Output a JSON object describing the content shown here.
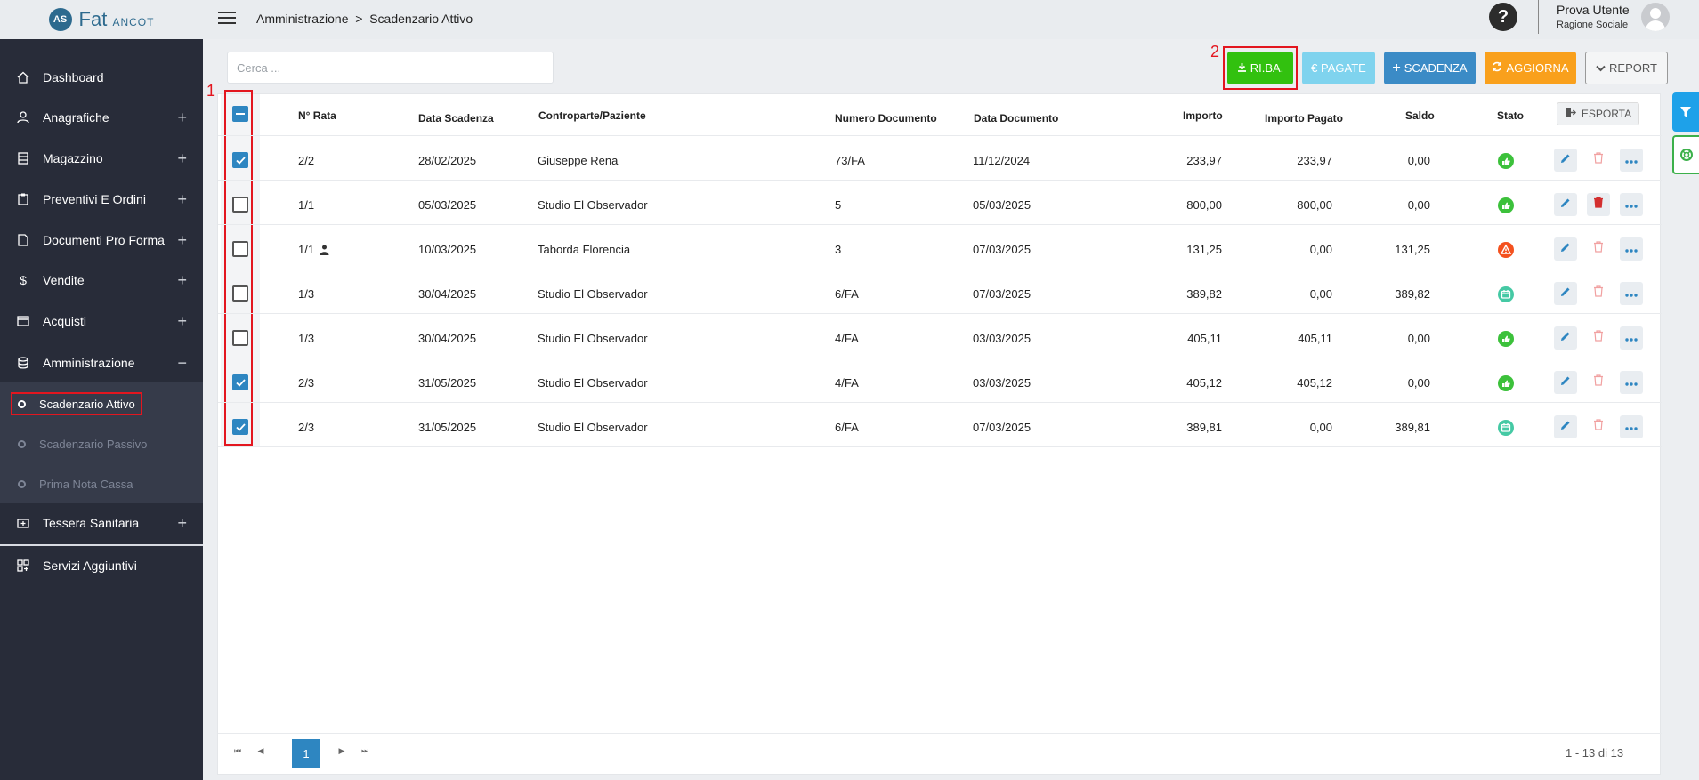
{
  "sidebar": {
    "logo_mark": "AS",
    "logo_text": "Fat",
    "logo_sub": "ANCOT",
    "items": [
      {
        "label": "Dashboard",
        "icon": "home-icon"
      },
      {
        "label": "Anagrafiche",
        "icon": "user-icon"
      },
      {
        "label": "Magazzino",
        "icon": "warehouse-icon"
      },
      {
        "label": "Preventivi E Ordini",
        "icon": "clipboard-icon"
      },
      {
        "label": "Documenti Pro Forma",
        "icon": "document-icon"
      },
      {
        "label": "Vendite",
        "icon": "dollar-icon"
      },
      {
        "label": "Acquisti",
        "icon": "card-icon"
      },
      {
        "label": "Amministrazione",
        "icon": "database-icon"
      },
      {
        "label": "Tessera Sanitaria",
        "icon": "medical-icon"
      },
      {
        "label": "Servizi Aggiuntivi",
        "icon": "apps-icon"
      }
    ],
    "submenu": [
      {
        "label": "Scadenzario Attivo"
      },
      {
        "label": "Scadenzario Passivo"
      },
      {
        "label": "Prima Nota Cassa"
      }
    ]
  },
  "topbar": {
    "breadcrumb": "Amministrazione  >  Scadenzario Attivo",
    "user_name": "Prova Utente",
    "user_role": "Ragione Sociale"
  },
  "toolbar": {
    "search_placeholder": "Cerca ...",
    "riba": "RI.BA.",
    "pagate": "€ PAGATE",
    "scadenza": "SCADENZA",
    "aggiorna": "AGGIORNA",
    "report": "REPORT",
    "annotation_1": "1",
    "annotation_2": "2"
  },
  "table": {
    "headers": {
      "rata": "N° Rata",
      "data_scadenza": "Data Scadenza",
      "controparte": "Controparte/Paziente",
      "numero_doc": "Numero Documento",
      "data_doc": "Data Documento",
      "importo": "Importo",
      "importo_pagato": "Importo Pagato",
      "saldo": "Saldo",
      "stato": "Stato",
      "esporta": "ESPORTA"
    },
    "rows": [
      {
        "checked": true,
        "rata": "2/2",
        "scadenza": "28/02/2025",
        "controparte": "Giuseppe Rena",
        "numero": "73/FA",
        "data_doc": "11/12/2024",
        "importo": "233,97",
        "pagato": "233,97",
        "saldo": "0,00",
        "stato": "paid",
        "delete_enabled": false
      },
      {
        "checked": false,
        "rata": "1/1",
        "scadenza": "05/03/2025",
        "controparte": "Studio El Observador",
        "numero": "5",
        "data_doc": "05/03/2025",
        "importo": "800,00",
        "pagato": "800,00",
        "saldo": "0,00",
        "stato": "paid",
        "delete_enabled": true
      },
      {
        "checked": false,
        "rata": "1/1",
        "scadenza": "10/03/2025",
        "controparte": "Taborda Florencia",
        "numero": "3",
        "data_doc": "07/03/2025",
        "importo": "131,25",
        "pagato": "0,00",
        "saldo": "131,25",
        "stato": "overdue",
        "delete_enabled": false,
        "has_person_icon": true
      },
      {
        "checked": false,
        "rata": "1/3",
        "scadenza": "30/04/2025",
        "controparte": "Studio El Observador",
        "numero": "6/FA",
        "data_doc": "07/03/2025",
        "importo": "389,82",
        "pagato": "0,00",
        "saldo": "389,82",
        "stato": "pending",
        "delete_enabled": false
      },
      {
        "checked": false,
        "rata": "1/3",
        "scadenza": "30/04/2025",
        "controparte": "Studio El Observador",
        "numero": "4/FA",
        "data_doc": "03/03/2025",
        "importo": "405,11",
        "pagato": "405,11",
        "saldo": "0,00",
        "stato": "paid",
        "delete_enabled": false
      },
      {
        "checked": true,
        "rata": "2/3",
        "scadenza": "31/05/2025",
        "controparte": "Studio El Observador",
        "numero": "4/FA",
        "data_doc": "03/03/2025",
        "importo": "405,12",
        "pagato": "405,12",
        "saldo": "0,00",
        "stato": "paid",
        "delete_enabled": false
      },
      {
        "checked": true,
        "rata": "2/3",
        "scadenza": "31/05/2025",
        "controparte": "Studio El Observador",
        "numero": "6/FA",
        "data_doc": "07/03/2025",
        "importo": "389,81",
        "pagato": "0,00",
        "saldo": "389,81",
        "stato": "pending",
        "delete_enabled": false
      }
    ]
  },
  "pagination": {
    "current_page": "1",
    "info": "1 - 13 di 13"
  },
  "colors": {
    "sidebar_bg": "#282c39",
    "accent_blue": "#2e86c1",
    "riba_green": "#32c10f",
    "annotation_red": "#e3161f",
    "status_paid": "#3cc13b",
    "status_overdue": "#f4511e",
    "status_pending": "#45c9a4"
  }
}
